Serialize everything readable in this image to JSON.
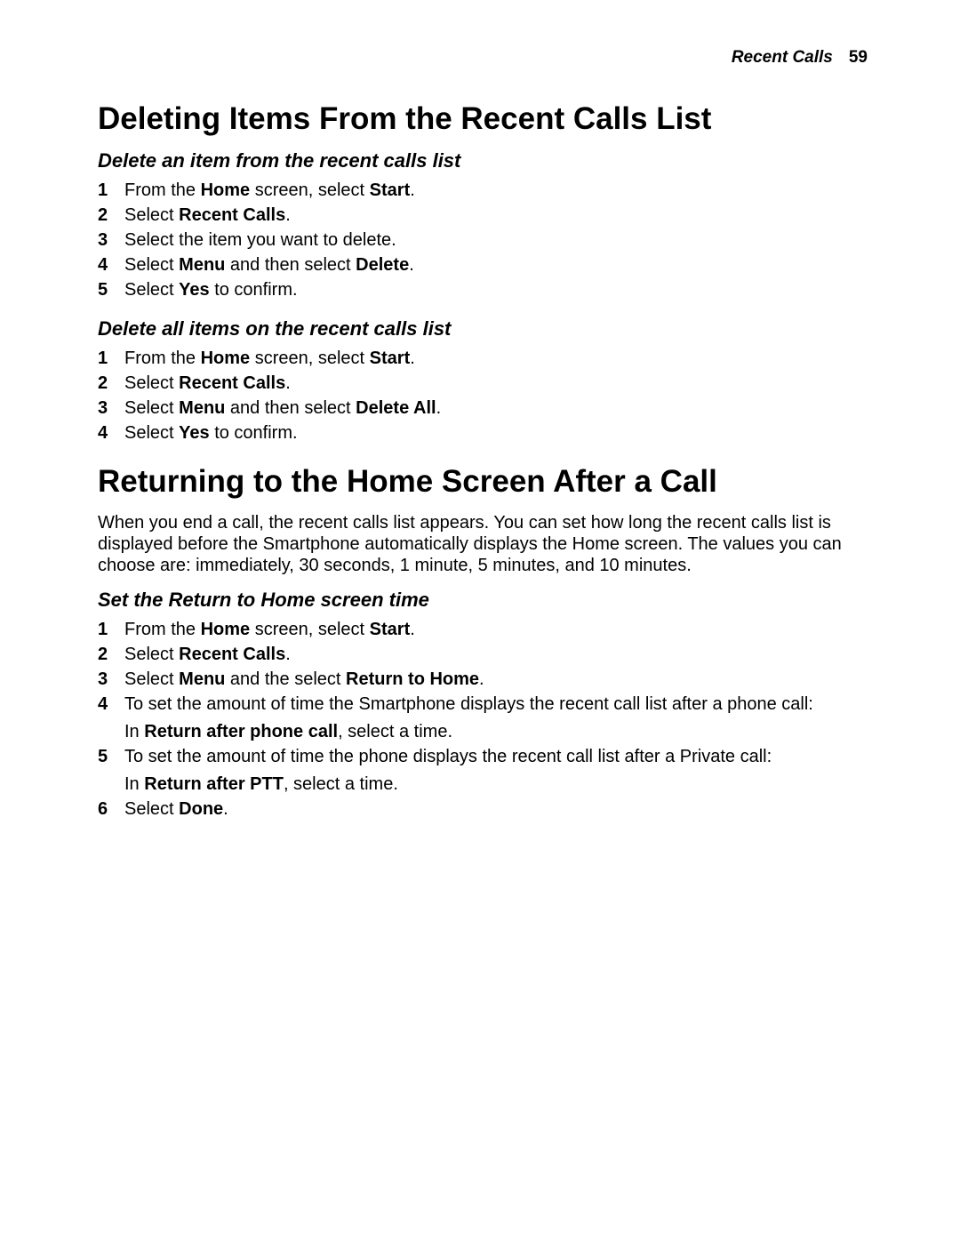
{
  "header": {
    "section": "Recent Calls",
    "page": "59"
  },
  "s1": {
    "title": "Deleting Items From the Recent Calls List",
    "sub1": {
      "title": "Delete an item from the recent calls list",
      "steps": [
        {
          "n": "1",
          "pre": "From the ",
          "b1": "Home",
          "mid": " screen, select ",
          "b2": "Start",
          "post": "."
        },
        {
          "n": "2",
          "pre": "Select ",
          "b1": "Recent Calls",
          "post": "."
        },
        {
          "n": "3",
          "plain": "Select the item you want to delete."
        },
        {
          "n": "4",
          "pre": "Select ",
          "b1": "Menu",
          "mid": " and then select ",
          "b2": "Delete",
          "post": "."
        },
        {
          "n": "5",
          "pre": "Select ",
          "b1": "Yes",
          "post": " to confirm."
        }
      ]
    },
    "sub2": {
      "title": "Delete all items on the recent calls list",
      "steps": [
        {
          "n": "1",
          "pre": "From the ",
          "b1": "Home",
          "mid": " screen, select ",
          "b2": "Start",
          "post": "."
        },
        {
          "n": "2",
          "pre": "Select ",
          "b1": "Recent Calls",
          "post": "."
        },
        {
          "n": "3",
          "pre": "Select ",
          "b1": "Menu",
          "mid": " and then select ",
          "b2": "Delete All",
          "post": "."
        },
        {
          "n": "4",
          "pre": "Select ",
          "b1": "Yes",
          "post": " to confirm."
        }
      ]
    }
  },
  "s2": {
    "title": "Returning to the Home Screen After a Call",
    "intro": "When you end a call, the recent calls list appears. You can set how long the recent calls list is displayed before the Smartphone automatically displays the Home screen. The values you can choose are: immediately, 30 seconds, 1 minute, 5 minutes, and 10 minutes.",
    "sub1": {
      "title": "Set the Return to Home screen time",
      "steps": [
        {
          "n": "1",
          "pre": "From the ",
          "b1": "Home",
          "mid": " screen, select ",
          "b2": "Start",
          "post": "."
        },
        {
          "n": "2",
          "pre": "Select ",
          "b1": "Recent Calls",
          "post": "."
        },
        {
          "n": "3",
          "pre": "Select ",
          "b1": "Menu",
          "mid": " and the select ",
          "b2": "Return to Home",
          "post": "."
        },
        {
          "n": "4",
          "plain": "To set the amount of time the Smartphone displays the recent call list after a phone call:",
          "sub_pre": "In ",
          "sub_b": "Return after phone call",
          "sub_post": ", select a time."
        },
        {
          "n": "5",
          "plain": "To set the amount of time the phone displays the recent call list after a Private call:",
          "sub_pre": "In ",
          "sub_b": "Return after PTT",
          "sub_post": ", select a time."
        },
        {
          "n": "6",
          "pre": "Select ",
          "b1": "Done",
          "post": "."
        }
      ]
    }
  }
}
